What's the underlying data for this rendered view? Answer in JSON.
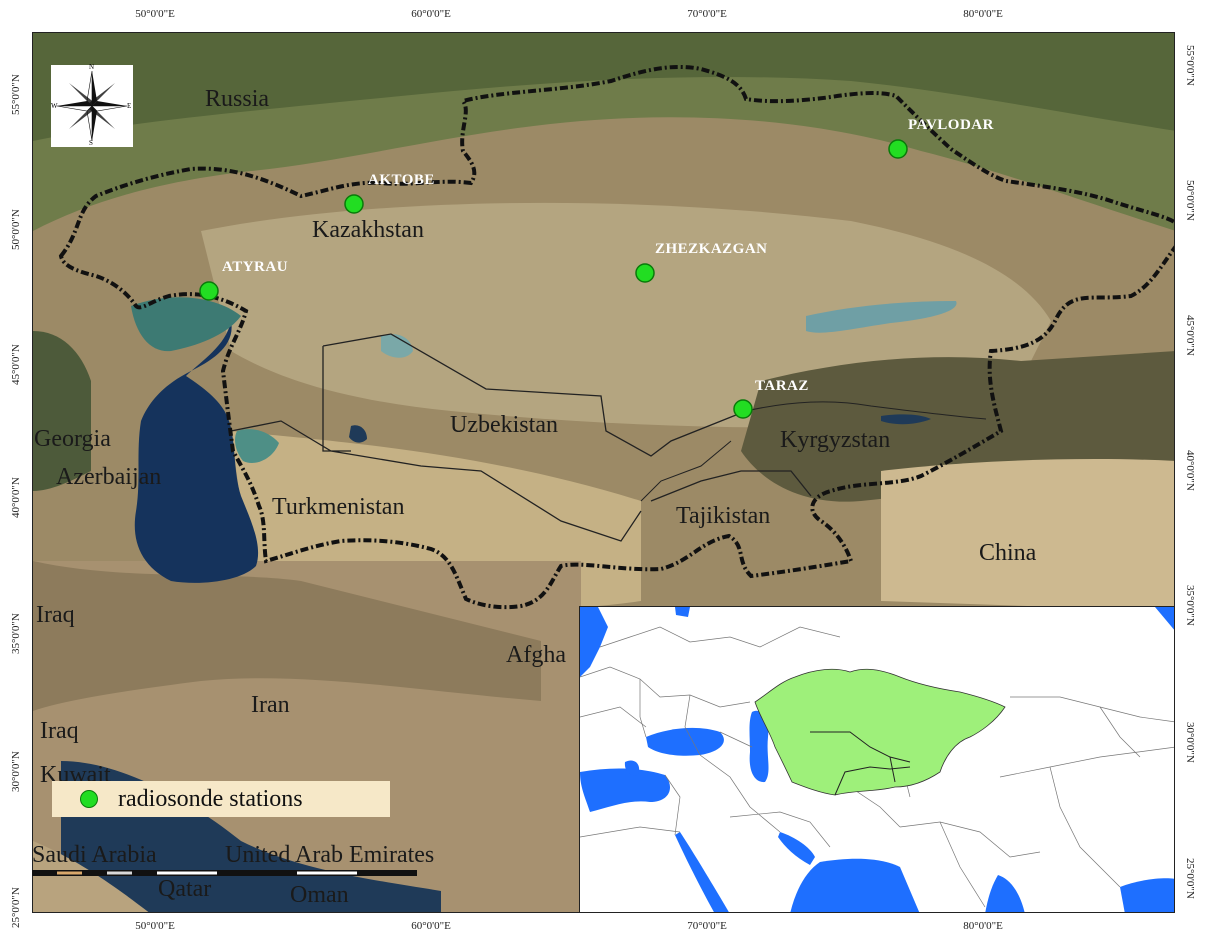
{
  "map": {
    "countries": [
      {
        "name": "Russia"
      },
      {
        "name": "Kazakhstan"
      },
      {
        "name": "Uzbekistan"
      },
      {
        "name": "Kyrgyzstan"
      },
      {
        "name": "Turkmenistan"
      },
      {
        "name": "Tajikistan"
      },
      {
        "name": "China"
      },
      {
        "name": "Georgia"
      },
      {
        "name": "Azerbaijan"
      },
      {
        "name": "Iraq"
      },
      {
        "name": "Iran"
      },
      {
        "name": "Iraq"
      },
      {
        "name": "Kuwait"
      },
      {
        "name": "Afgha"
      },
      {
        "name": "Saudi Arabia"
      },
      {
        "name": "United Arab Emirates"
      },
      {
        "name": "Qatar"
      },
      {
        "name": "Oman"
      }
    ],
    "stations": [
      {
        "name": "AKTOBE"
      },
      {
        "name": "PAVLODAR"
      },
      {
        "name": "ATYRAU"
      },
      {
        "name": "ZHEZKAZGAN"
      },
      {
        "name": "TARAZ"
      }
    ],
    "lon_ticks": [
      "50°0'0\"E",
      "60°0'0\"E",
      "70°0'0\"E",
      "80°0'0\"E"
    ],
    "lat_ticks": [
      "55°0'0\"N",
      "50°0'0\"N",
      "45°0'0\"N",
      "40°0'0\"N",
      "35°0'0\"N",
      "30°0'0\"N",
      "25°0'0\"N"
    ],
    "legend": {
      "label": "radiosonde stations"
    },
    "compass": {
      "n": "N",
      "s": "S",
      "e": "E",
      "w": "W"
    },
    "colors": {
      "station": "#22dd22",
      "study_area_inset": "#9ef07a",
      "water_inset": "#1e6fff",
      "legend_bg": "#f6e8c8"
    }
  }
}
